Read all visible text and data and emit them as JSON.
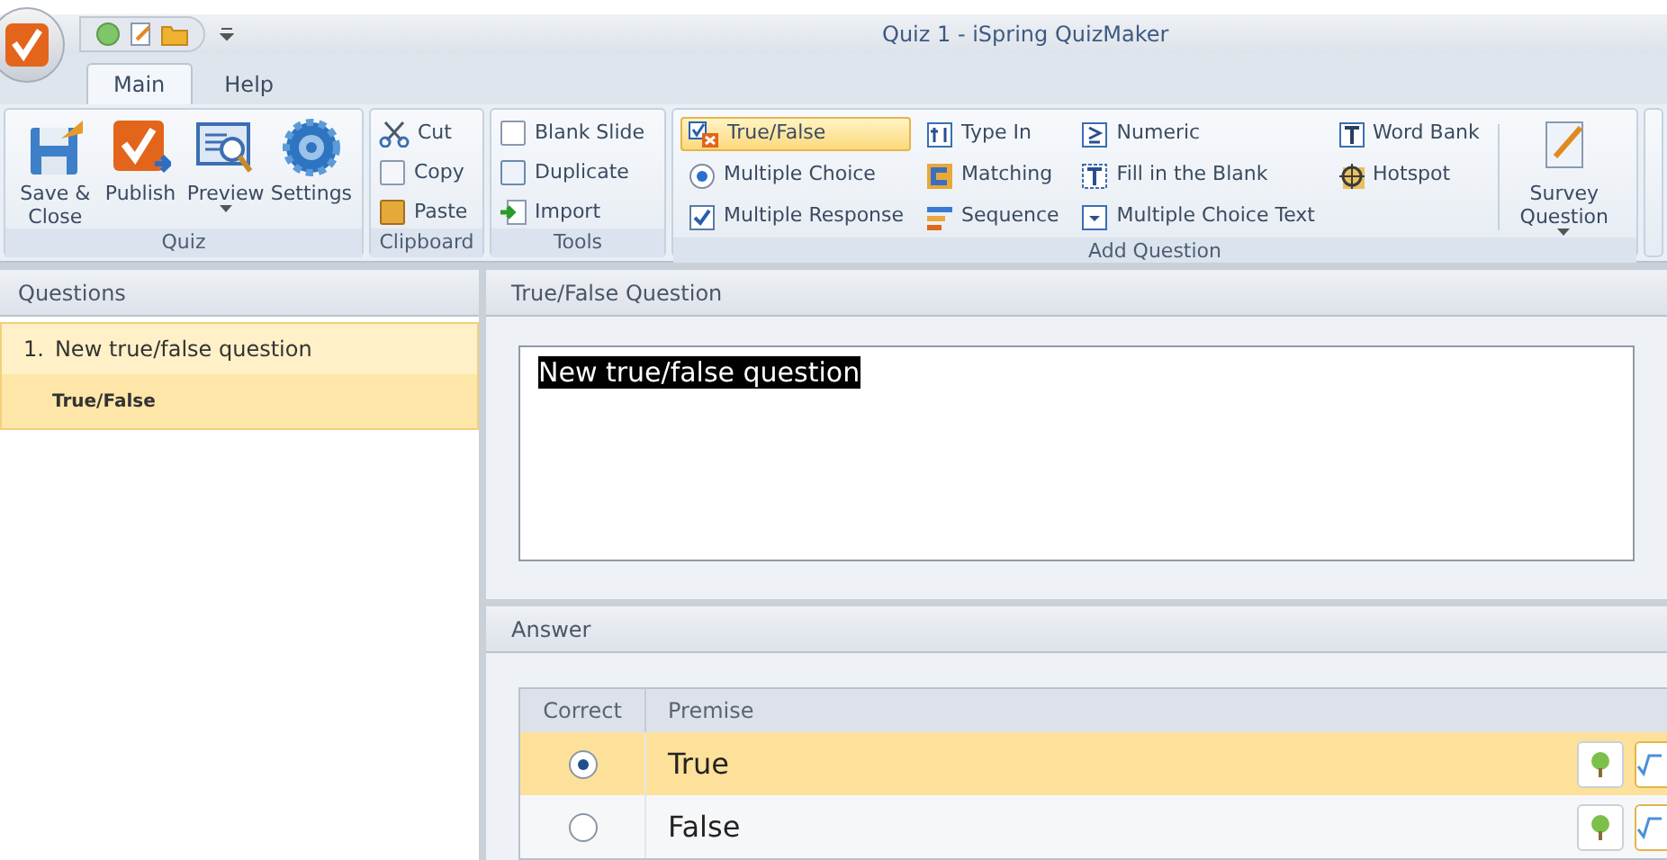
{
  "window": {
    "title": "Quiz 1 - iSpring QuizMaker"
  },
  "tabs": [
    {
      "label": "Main",
      "selected": true
    },
    {
      "label": "Help",
      "selected": false
    }
  ],
  "ribbon": {
    "quiz": {
      "label": "Quiz",
      "buttons": [
        {
          "label": "Save & Close"
        },
        {
          "label": "Publish"
        },
        {
          "label": "Preview",
          "dropdown": true
        },
        {
          "label": "Settings"
        }
      ]
    },
    "clipboard": {
      "label": "Clipboard",
      "buttons": [
        {
          "label": "Cut"
        },
        {
          "label": "Copy"
        },
        {
          "label": "Paste"
        }
      ]
    },
    "tools": {
      "label": "Tools",
      "buttons": [
        {
          "label": "Blank Slide"
        },
        {
          "label": "Duplicate"
        },
        {
          "label": "Import"
        }
      ]
    },
    "add_question": {
      "label": "Add Question",
      "columns": [
        [
          {
            "label": "True/False",
            "selected": true
          },
          {
            "label": "Multiple Choice",
            "selected": false
          },
          {
            "label": "Multiple Response",
            "selected": false
          }
        ],
        [
          {
            "label": "Type In",
            "selected": false
          },
          {
            "label": "Matching",
            "selected": false
          },
          {
            "label": "Sequence",
            "selected": false
          }
        ],
        [
          {
            "label": "Numeric",
            "selected": false
          },
          {
            "label": "Fill in the Blank",
            "selected": false
          },
          {
            "label": "Multiple Choice Text",
            "selected": false
          }
        ],
        [
          {
            "label": "Word Bank",
            "selected": false
          },
          {
            "label": "Hotspot",
            "selected": false
          }
        ]
      ],
      "survey": {
        "label": "Survey Question"
      }
    }
  },
  "questions_panel": {
    "title": "Questions",
    "items": [
      {
        "number": "1.",
        "title": "New true/false question",
        "type": "True/False",
        "selected": true
      }
    ]
  },
  "question_panel": {
    "title": "True/False Question",
    "text": "New true/false question"
  },
  "answer_panel": {
    "title": "Answer",
    "columns": [
      "Correct",
      "Premise"
    ],
    "rows": [
      {
        "premise": "True",
        "selected": true
      },
      {
        "premise": "False",
        "selected": false
      }
    ]
  }
}
